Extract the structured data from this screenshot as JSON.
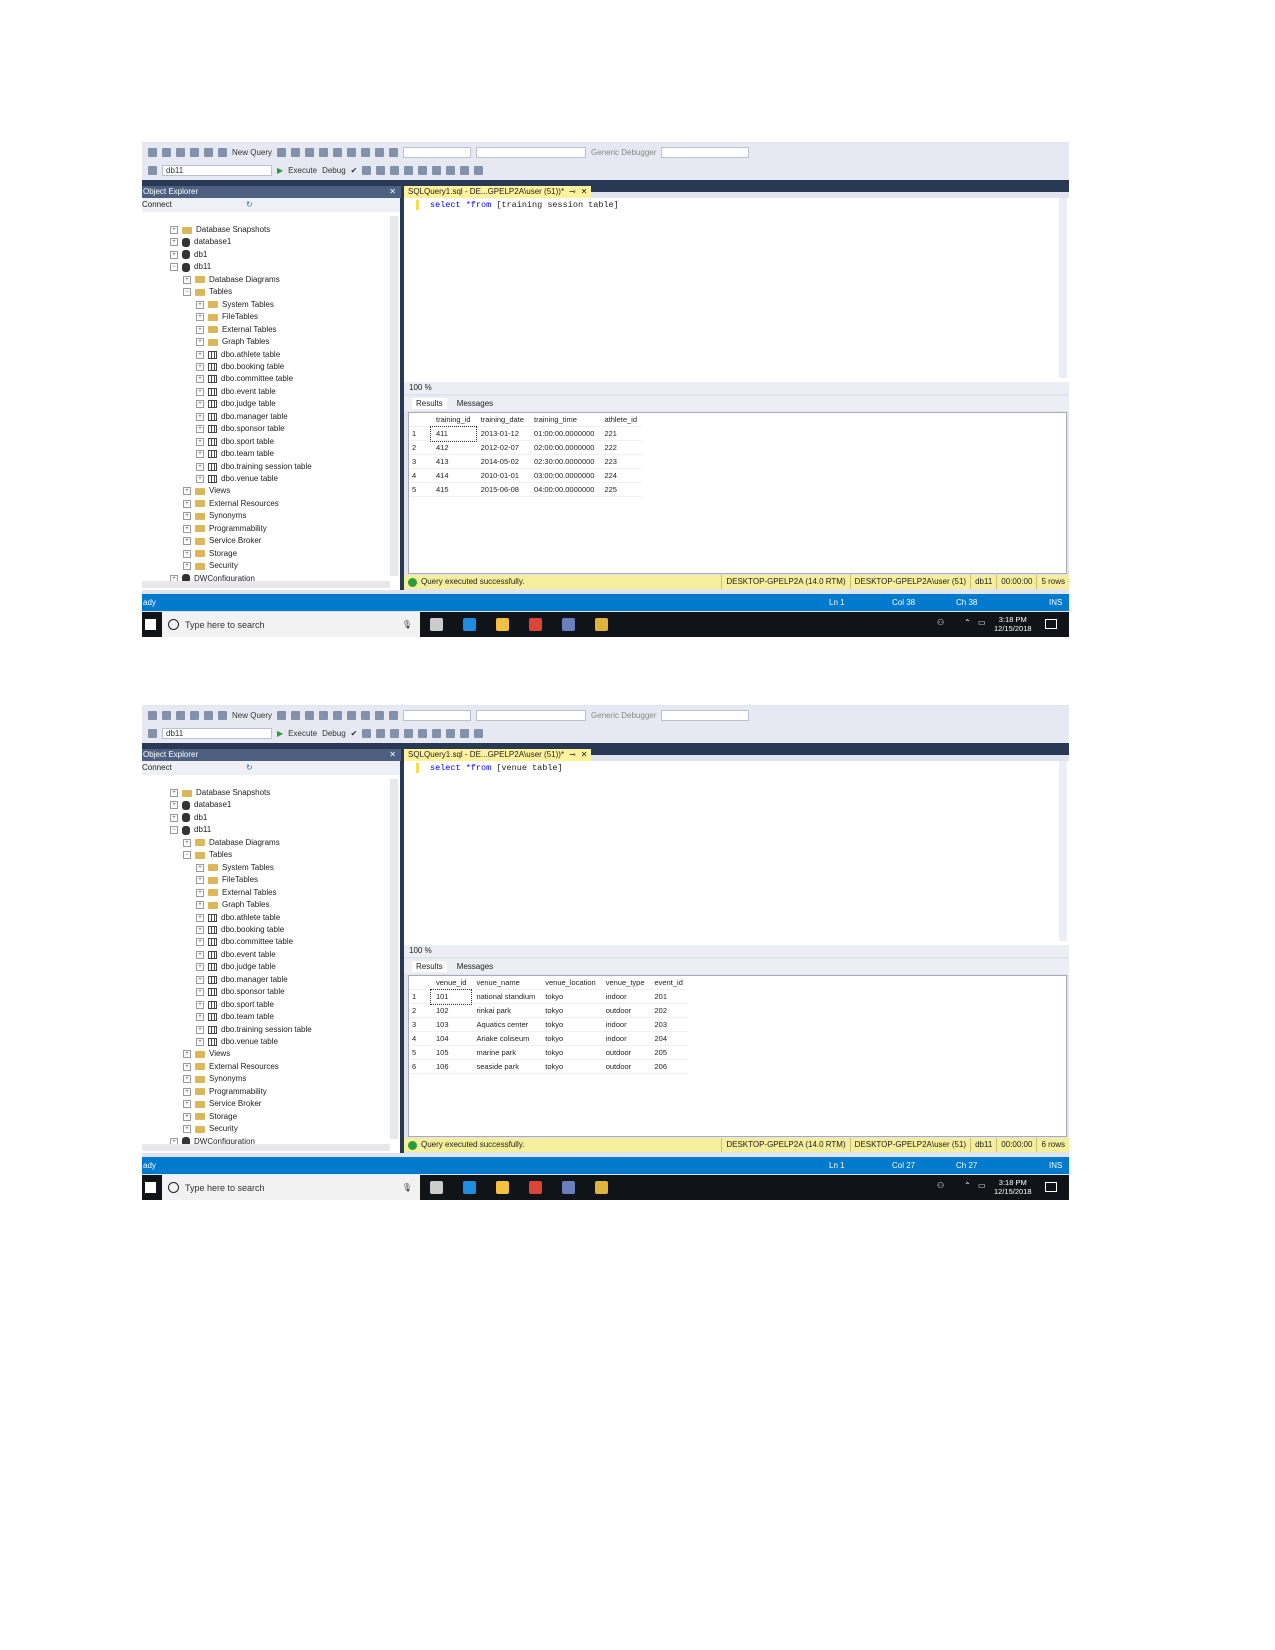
{
  "common": {
    "toolbar": {
      "new_query": "New Query",
      "generic_debugger": "Generic Debugger",
      "database": "db11",
      "execute": "Execute",
      "debug": "Debug"
    },
    "object_explorer": {
      "title": "Object Explorer",
      "connect": "Connect"
    },
    "tree": [
      {
        "label": "Database Snapshots",
        "level": 0,
        "icon": "folder",
        "expanded": false
      },
      {
        "label": "database1",
        "level": 0,
        "icon": "database",
        "expanded": false
      },
      {
        "label": "db1",
        "level": 0,
        "icon": "database",
        "expanded": false
      },
      {
        "label": "db11",
        "level": 0,
        "icon": "database",
        "expanded": true
      },
      {
        "label": "Database Diagrams",
        "level": 1,
        "icon": "folder",
        "expanded": false
      },
      {
        "label": "Tables",
        "level": 1,
        "icon": "folder",
        "expanded": true
      },
      {
        "label": "System Tables",
        "level": 2,
        "icon": "folder",
        "expanded": false
      },
      {
        "label": "FileTables",
        "level": 2,
        "icon": "folder",
        "expanded": false
      },
      {
        "label": "External Tables",
        "level": 2,
        "icon": "folder",
        "expanded": false
      },
      {
        "label": "Graph Tables",
        "level": 2,
        "icon": "folder",
        "expanded": false
      },
      {
        "label": "dbo.athlete table",
        "level": 2,
        "icon": "table",
        "expanded": false
      },
      {
        "label": "dbo.booking table",
        "level": 2,
        "icon": "table",
        "expanded": false
      },
      {
        "label": "dbo.committee table",
        "level": 2,
        "icon": "table",
        "expanded": false
      },
      {
        "label": "dbo.event table",
        "level": 2,
        "icon": "table",
        "expanded": false
      },
      {
        "label": "dbo.judge table",
        "level": 2,
        "icon": "table",
        "expanded": false
      },
      {
        "label": "dbo.manager table",
        "level": 2,
        "icon": "table",
        "expanded": false
      },
      {
        "label": "dbo.sponsor table",
        "level": 2,
        "icon": "table",
        "expanded": false
      },
      {
        "label": "dbo.sport table",
        "level": 2,
        "icon": "table",
        "expanded": false
      },
      {
        "label": "dbo.team table",
        "level": 2,
        "icon": "table",
        "expanded": false
      },
      {
        "label": "dbo.training session table",
        "level": 2,
        "icon": "table",
        "expanded": false
      },
      {
        "label": "dbo.venue table",
        "level": 2,
        "icon": "table",
        "expanded": false
      },
      {
        "label": "Views",
        "level": 1,
        "icon": "folder",
        "expanded": false
      },
      {
        "label": "External Resources",
        "level": 1,
        "icon": "folder",
        "expanded": false
      },
      {
        "label": "Synonyms",
        "level": 1,
        "icon": "folder",
        "expanded": false
      },
      {
        "label": "Programmability",
        "level": 1,
        "icon": "folder",
        "expanded": false
      },
      {
        "label": "Service Broker",
        "level": 1,
        "icon": "folder",
        "expanded": false
      },
      {
        "label": "Storage",
        "level": 1,
        "icon": "folder",
        "expanded": false
      },
      {
        "label": "Security",
        "level": 1,
        "icon": "folder",
        "expanded": false
      },
      {
        "label": "DWConfiguration",
        "level": 0,
        "icon": "database",
        "expanded": false
      }
    ],
    "tab_title": "SQLQuery1.sql - DE...GPELP2A\\user (51))*",
    "zoom": "100 %",
    "results_tab": "Results",
    "messages_tab": "Messages",
    "status_message": "Query executed successfully.",
    "server": "DESKTOP-GPELP2A (14.0 RTM)",
    "user": "DESKTOP-GPELP2A\\user (51)",
    "db": "db11",
    "elapsed": "00:00:00",
    "ready": "ady",
    "ln": "Ln 1",
    "ins": "INS",
    "taskbar": {
      "search_placeholder": "Type here to search",
      "time": "3:18 PM",
      "date": "12/15/2018"
    },
    "colors": {
      "accent": "#007acc",
      "tab": "#fff29d",
      "status": "#f5ee9c",
      "navy": "#293955"
    }
  },
  "screenshots": [
    {
      "query_kw": "select",
      "query_rest": " *from ",
      "query_obj": "[training session table]",
      "col": "Col 38",
      "ch": "Ch 38",
      "rows": "5 rows",
      "columns": [
        "training_id",
        "training_date",
        "training_time",
        "athlete_id"
      ],
      "data": [
        [
          "411",
          "2013-01-12",
          "01:00:00.0000000",
          "221"
        ],
        [
          "412",
          "2012-02-07",
          "02:00:00.0000000",
          "222"
        ],
        [
          "413",
          "2014-05-02",
          "02:30:00.0000000",
          "223"
        ],
        [
          "414",
          "2010-01-01",
          "03:00:00.0000000",
          "224"
        ],
        [
          "415",
          "2015-06-08",
          "04:00:00.0000000",
          "225"
        ]
      ]
    },
    {
      "query_kw": "select",
      "query_rest": " *from ",
      "query_obj": "[venue table]",
      "col": "Col 27",
      "ch": "Ch 27",
      "rows": "6 rows",
      "columns": [
        "venue_id",
        "venue_name",
        "venue_location",
        "venue_type",
        "event_id"
      ],
      "data": [
        [
          "101",
          "national standium",
          "tokyo",
          "indoor",
          "201"
        ],
        [
          "102",
          "rinkai park",
          "tokyo",
          "outdoor",
          "202"
        ],
        [
          "103",
          "Aquatics center",
          "tokyo",
          "indoor",
          "203"
        ],
        [
          "104",
          "Ariake coliseum",
          "tokyo",
          "indoor",
          "204"
        ],
        [
          "105",
          "marine park",
          "tokyo",
          "outdoor",
          "205"
        ],
        [
          "106",
          "seaside park",
          "tokyo",
          "outdoor",
          "206"
        ]
      ]
    }
  ]
}
